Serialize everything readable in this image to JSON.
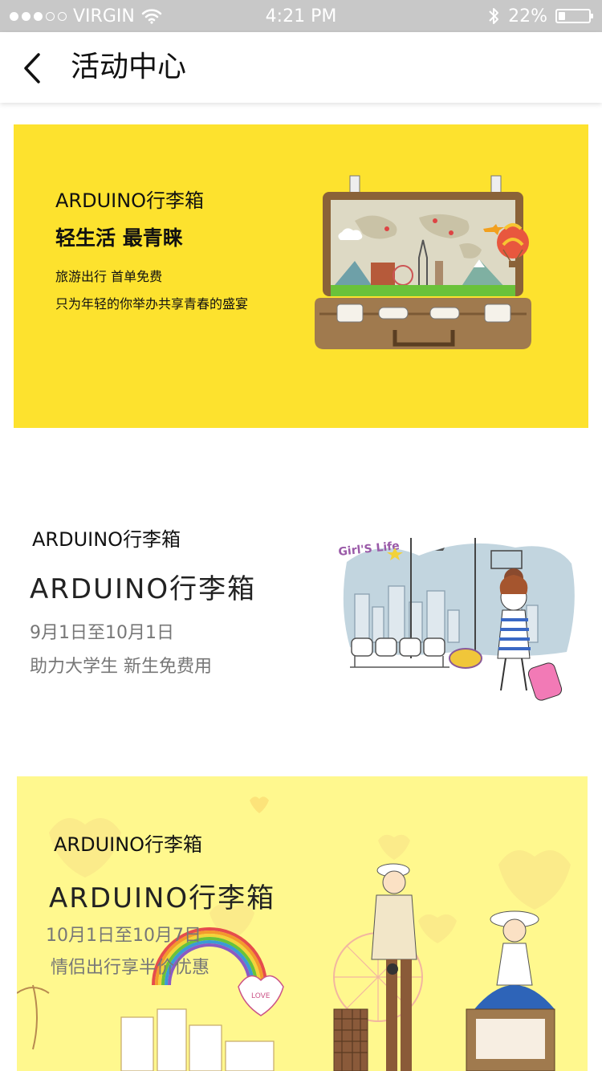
{
  "status_bar": {
    "carrier": "VIRGIN",
    "time": "4:21 PM",
    "battery": "22%",
    "battery_level": 0.22
  },
  "header": {
    "back_icon": "chevron-left-icon",
    "title": "活动中心"
  },
  "cards": [
    {
      "brand": "ARDUINO行李箱",
      "headline": "轻生活 最青睐",
      "lines": [
        "旅游出行 首单免费",
        "只为年轻的你举办共享青春的盛宴"
      ],
      "background": "#fde22e"
    },
    {
      "brand": "ARDUINO行李箱",
      "title": "ARDUINO行李箱",
      "dates": "9月1日至10月1日",
      "subtitle": "助力大学生 新生免费用",
      "sign_text": "Girl'S Life"
    },
    {
      "brand": "ARDUINO行李箱",
      "title": "ARDUINO行李箱",
      "dates": "10月1日至10月7日",
      "subtitle": "情侣出行享半价优惠",
      "heart_text": "LOVE",
      "background": "#fff88e"
    }
  ]
}
